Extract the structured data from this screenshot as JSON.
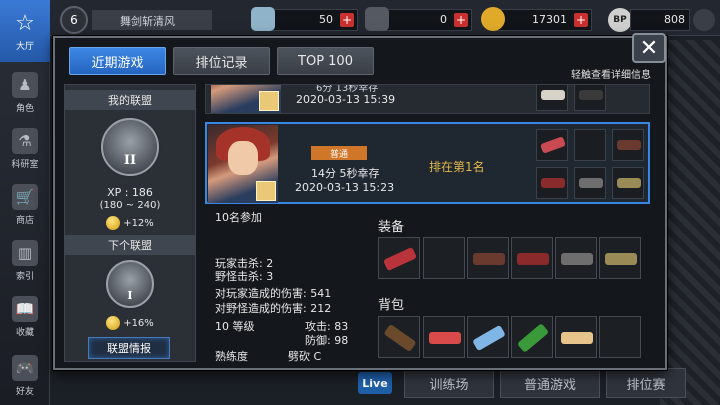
{
  "background": {
    "nav": [
      {
        "label": "大厅",
        "icon": "star-icon"
      },
      {
        "label": "角色",
        "icon": "character-icon"
      },
      {
        "label": "科研室",
        "icon": "research-icon"
      },
      {
        "label": "商店",
        "icon": "cart-icon"
      },
      {
        "label": "索引",
        "icon": "book-index-icon"
      },
      {
        "label": "收藏",
        "icon": "collection-icon"
      },
      {
        "label": "好友",
        "icon": "gamepad-icon"
      }
    ],
    "level": "6",
    "player_name": "舞剑斩清风",
    "resources": [
      {
        "value": "50",
        "color": "#8fb3c9"
      },
      {
        "value": "0",
        "color": "#555a62"
      },
      {
        "value": "17301",
        "color": "#e0a92a"
      }
    ],
    "bp_label": "BP",
    "bp_value": "808",
    "bottom_buttons": [
      "训练场",
      "普通游戏",
      "排位赛"
    ],
    "live_label": "Live"
  },
  "modal": {
    "tabs": [
      "近期游戏",
      "排位记录",
      "TOP 100"
    ],
    "active_tab": 0,
    "hint": "轻触查看详细信息",
    "close_label": "✕"
  },
  "league": {
    "my_league_title": "我的联盟",
    "my_rank": "II",
    "xp": "XP : 186",
    "xp_range": "(180 ~ 240)",
    "my_bonus": "+12%",
    "next_league_title": "下个联盟",
    "next_rank": "I",
    "next_bonus": "+16%",
    "info_button": "联盟情报"
  },
  "matches": [
    {
      "time_survived": "6分 13秒幸存",
      "date": "2020-03-13 15:39"
    },
    {
      "mode": "普通",
      "time_survived": "14分 5秒幸存",
      "date": "2020-03-13 15:23",
      "rank": "排在第1名"
    }
  ],
  "detail": {
    "participants": "10名参加",
    "player_kills": "玩家击杀: 2",
    "monster_kills": "野怪击杀: 3",
    "player_damage": "对玩家造成的伤害: 541",
    "monster_damage": "对野怪造成的伤害: 212",
    "level": "10 等级",
    "attack": "攻击: 83",
    "defense": "防御: 98",
    "proficiency_label": "熟练度",
    "proficiency_value": "劈砍 C",
    "equipment_label": "装备",
    "backpack_label": "背包",
    "equipment_colors": [
      "#b8333a",
      "#2a2d33",
      "#6b3a2e",
      "#8a2a2a",
      "#6e6e6e",
      "#9a8a55"
    ],
    "backpack_colors": [
      "#6a4a2a",
      "#d94a4a",
      "#7fb6e6",
      "#3a9a3a",
      "#e7c58a",
      "#2a2d33"
    ]
  }
}
